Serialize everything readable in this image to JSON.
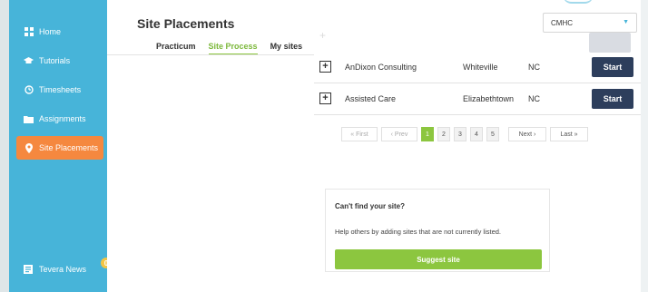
{
  "sidebar": {
    "items": [
      {
        "label": "Home",
        "icon": "grid-icon"
      },
      {
        "label": "Tutorials",
        "icon": "graduation-cap-icon"
      },
      {
        "label": "Timesheets",
        "icon": "clock-icon"
      },
      {
        "label": "Assignments",
        "icon": "folder-icon"
      },
      {
        "label": "Site Placements",
        "icon": "map-pin-icon",
        "active": true
      }
    ],
    "news": {
      "label": "Tevera News",
      "badge": "0"
    }
  },
  "header": {
    "title": "Site Placements",
    "tabs": [
      {
        "label": "Practicum"
      },
      {
        "label": "Site Process",
        "active": true
      },
      {
        "label": "My sites"
      }
    ]
  },
  "filter": {
    "selected": "CMHC"
  },
  "sites": [
    {
      "name": "AnDixon Consulting",
      "city": "Whiteville",
      "state": "NC",
      "action": "Start"
    },
    {
      "name": "Assisted Care",
      "city": "Elizabethtown",
      "state": "NC",
      "action": "Start"
    }
  ],
  "pagination": {
    "first": "« First",
    "prev": "‹ Prev",
    "pages": [
      "1",
      "2",
      "3",
      "4",
      "5"
    ],
    "current": "1",
    "next": "Next ›",
    "last": "Last »"
  },
  "suggest": {
    "title": "Can't find your site?",
    "description": "Help others by adding sites that are not currently listed.",
    "button": "Suggest site"
  },
  "colors": {
    "sidebar": "#47b4d9",
    "active_nav": "#f5883f",
    "accent_green": "#8cc63f",
    "start_button": "#2d3e5c"
  }
}
